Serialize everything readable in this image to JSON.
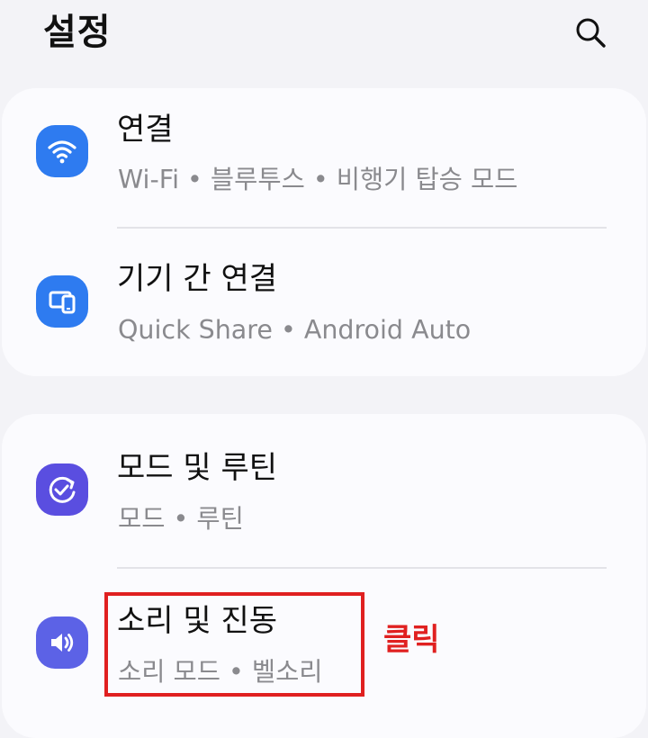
{
  "header": {
    "title": "설정",
    "search_icon": "search-icon"
  },
  "groups": [
    {
      "items": [
        {
          "icon": "wifi-icon",
          "icon_color": "#2e7bf0",
          "title": "연결",
          "subtitle": "Wi-Fi  •  블루투스  •  비행기 탑승 모드"
        },
        {
          "icon": "device-connection-icon",
          "icon_color": "#2e7bf0",
          "title": "기기 간 연결",
          "subtitle": "Quick Share  •  Android Auto"
        }
      ]
    },
    {
      "items": [
        {
          "icon": "routine-check-icon",
          "icon_color": "#5a4ee0",
          "title": "모드 및 루틴",
          "subtitle": "모드  •  루틴"
        },
        {
          "icon": "volume-icon",
          "icon_color": "#5c62e6",
          "title": "소리 및 진동",
          "subtitle": "소리 모드  •  벨소리"
        }
      ]
    }
  ],
  "annotation": {
    "label": "클릭",
    "color": "#e02020"
  }
}
